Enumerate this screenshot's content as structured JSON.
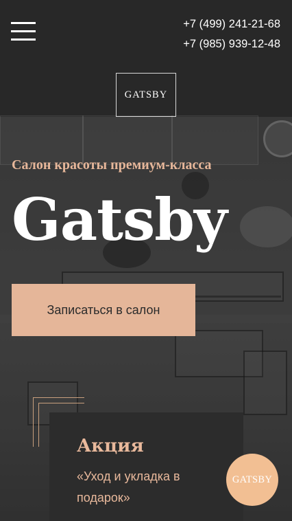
{
  "header": {
    "menu_icon": "hamburger-menu-icon",
    "phones": [
      "+7 (499) 241-21-68",
      "+7 (985) 939-12-48"
    ],
    "logo_text": "GATSBY"
  },
  "hero": {
    "subtitle": "Салон красоты премиум-класса",
    "title": "Gatsby",
    "cta_label": "Записаться в салон"
  },
  "promo": {
    "title": "Акция",
    "text": "«Уход и укладка в подарок»"
  },
  "badge": {
    "text": "GATSBY"
  },
  "colors": {
    "accent": "#e5b699",
    "accent_text": "#e9b99c",
    "promo_bg": "#2c2c2c",
    "badge_bg": "#f2bf93"
  }
}
